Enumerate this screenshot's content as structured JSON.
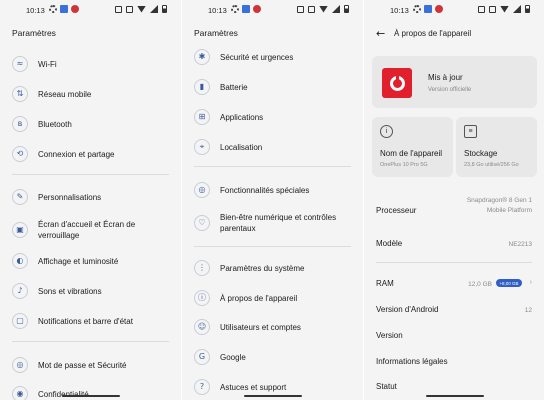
{
  "status": {
    "time": "10:13",
    "left_icons": [
      "gear-icon",
      "notification-app-icon",
      "alert-app-icon"
    ],
    "right_icons": [
      "nfc-icon",
      "vibrate-icon",
      "wifi-icon",
      "signal-icon",
      "battery-icon"
    ]
  },
  "panel1": {
    "title": "Paramètres",
    "items": [
      {
        "label": "Wi-Fi",
        "icon": "wifi-icon",
        "glyph": "≈"
      },
      {
        "label": "Réseau mobile",
        "icon": "mobile-network-icon",
        "glyph": "⇅"
      },
      {
        "label": "Bluetooth",
        "icon": "bluetooth-icon",
        "glyph": "ʙ"
      },
      {
        "label": "Connexion et partage",
        "icon": "connection-share-icon",
        "glyph": "⟲"
      },
      {
        "label": "Personnalisations",
        "icon": "palette-icon",
        "glyph": "✎"
      },
      {
        "label": "Écran d'accueil et Écran de verrouillage",
        "icon": "home-lock-screen-icon",
        "glyph": "▣"
      },
      {
        "label": "Affichage et luminosité",
        "icon": "brightness-icon",
        "glyph": "◐"
      },
      {
        "label": "Sons et vibrations",
        "icon": "sound-icon",
        "glyph": "♪"
      },
      {
        "label": "Notifications et barre d'état",
        "icon": "notifications-icon",
        "glyph": "▢"
      },
      {
        "label": "Mot de passe et Sécurité",
        "icon": "password-security-icon",
        "glyph": "◎"
      },
      {
        "label": "Confidentialité",
        "icon": "privacy-icon",
        "glyph": "◉"
      }
    ]
  },
  "panel2": {
    "title": "Paramètres",
    "items": [
      {
        "label": "Sécurité et urgences",
        "icon": "emergency-icon",
        "glyph": "✱"
      },
      {
        "label": "Batterie",
        "icon": "battery-icon",
        "glyph": "▮"
      },
      {
        "label": "Applications",
        "icon": "apps-icon",
        "glyph": "⊞"
      },
      {
        "label": "Localisation",
        "icon": "location-icon",
        "glyph": "⌖"
      },
      {
        "label": "Fonctionnalités spéciales",
        "icon": "special-features-icon",
        "glyph": "◎"
      },
      {
        "label": "Bien-être numérique et contrôles parentaux",
        "icon": "wellbeing-icon",
        "glyph": "♡"
      },
      {
        "label": "Paramètres du système",
        "icon": "system-settings-icon",
        "glyph": "⋮"
      },
      {
        "label": "À propos de l'appareil",
        "icon": "about-device-icon",
        "glyph": "ⓘ"
      },
      {
        "label": "Utilisateurs et comptes",
        "icon": "users-accounts-icon",
        "glyph": "☺"
      },
      {
        "label": "Google",
        "icon": "google-icon",
        "glyph": "G"
      },
      {
        "label": "Astuces et support",
        "icon": "tips-support-icon",
        "glyph": "?"
      }
    ]
  },
  "panel3": {
    "title": "À propos de l'appareil",
    "update": {
      "title": "Mis à jour",
      "subtitle": "Version officielle"
    },
    "device_name": {
      "title": "Nom de l'appareil",
      "value": "OnePlus 10 Pro 5G"
    },
    "storage": {
      "title": "Stockage",
      "value": "23,8 Go utilisé/256 Go"
    },
    "rows": {
      "processor_label": "Processeur",
      "processor_value": "Snapdragon® 8 Gen 1 Mobile Platform",
      "model_label": "Modèle",
      "model_value": "NE2213",
      "ram_label": "RAM",
      "ram_value": "12,0 GB",
      "ram_badge": "+8,00 GB",
      "android_label": "Version d'Android",
      "android_value": "12",
      "version_label": "Version",
      "legal_label": "Informations légales",
      "status_label": "Statut"
    }
  }
}
